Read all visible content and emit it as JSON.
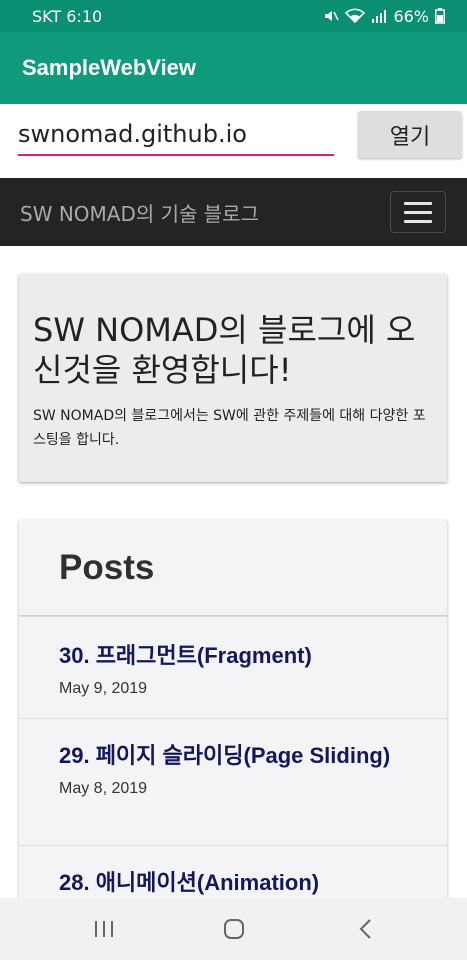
{
  "status": {
    "carrier_time": "SKT 6:10",
    "battery": "66%"
  },
  "appbar": {
    "title": "SampleWebView"
  },
  "url_bar": {
    "value": "swnomad.github.io",
    "open_label": "열기"
  },
  "site": {
    "brand": "SW NOMAD의 기술 블로그",
    "hero_title": "SW NOMAD의 블로그에 오신것을 환영합니다!",
    "hero_text": "SW NOMAD의 블로그에서는 SW에 관한 주제들에 대해 다양한 포스팅을 합니다.",
    "posts_heading": "Posts",
    "posts": [
      {
        "title": "30. 프래그먼트(Fragment)",
        "date": "May 9, 2019"
      },
      {
        "title": "29. 페이지 슬라이딩(Page Sliding)",
        "date": "May 8, 2019"
      },
      {
        "title": "28. 애니메이션(Animation)",
        "date": ""
      }
    ]
  },
  "icons": {
    "mute": "mute-icon",
    "wifi": "wifi-icon",
    "signal": "signal-icon",
    "battery": "battery-icon",
    "menu": "hamburger-icon",
    "recents": "recents-icon",
    "home": "home-icon",
    "back": "back-icon"
  },
  "colors": {
    "accent": "#0f9a7c",
    "underline": "#d6246e",
    "post_link": "#13175c",
    "navbar": "#242424"
  }
}
